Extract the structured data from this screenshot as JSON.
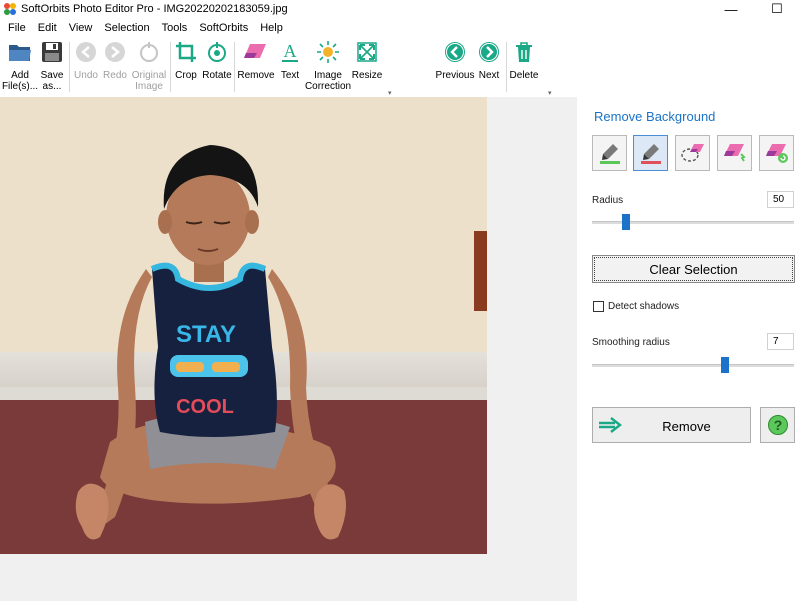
{
  "window": {
    "title": "SoftOrbits Photo Editor Pro - IMG20220202183059.jpg",
    "minimize_glyph": "—",
    "maximize_glyph": "☐"
  },
  "menu": [
    "File",
    "Edit",
    "View",
    "Selection",
    "Tools",
    "SoftOrbits",
    "Help"
  ],
  "toolbar": {
    "add_files": [
      "Add",
      "File(s)..."
    ],
    "save_as": [
      "Save",
      "as..."
    ],
    "undo": "Undo",
    "redo": "Redo",
    "original_image": [
      "Original",
      "Image"
    ],
    "crop": "Crop",
    "rotate": "Rotate",
    "remove": "Remove",
    "text": "Text",
    "image_correction": [
      "Image",
      "Correction"
    ],
    "resize": "Resize",
    "previous": "Previous",
    "next": "Next",
    "delete": "Delete",
    "more_glyph": "▾"
  },
  "panel": {
    "title": "Remove Background",
    "tools": [
      "keep-brush",
      "remove-brush",
      "lasso-eraser",
      "magic-eraser",
      "restore-eraser"
    ],
    "radius_label": "Radius",
    "radius_value": "50",
    "radius_level": 0.17,
    "clear_selection": "Clear Selection",
    "detect_shadows": "Detect shadows",
    "smoothing_label": "Smoothing radius",
    "smoothing_value": "7",
    "smoothing_level": 0.66,
    "remove_button": "Remove"
  },
  "colors": {
    "accent": "#1a73c8",
    "nav_green": "#1aa886",
    "keep_green": "#5cc85c",
    "remove_red": "#e0505a"
  },
  "icons": {
    "add_files": "folder-open-icon",
    "save_as": "floppy-disk-icon",
    "undo": "undo-arrow-icon",
    "redo": "redo-arrow-icon",
    "original": "original-image-icon",
    "crop": "crop-icon",
    "rotate": "rotate-icon",
    "remove": "eraser-icon",
    "text": "text-icon",
    "image_correction": "sun-icon",
    "resize": "resize-icon",
    "previous": "arrow-left-icon",
    "next": "arrow-right-icon",
    "delete": "trash-icon",
    "help": "question-mark-icon"
  }
}
